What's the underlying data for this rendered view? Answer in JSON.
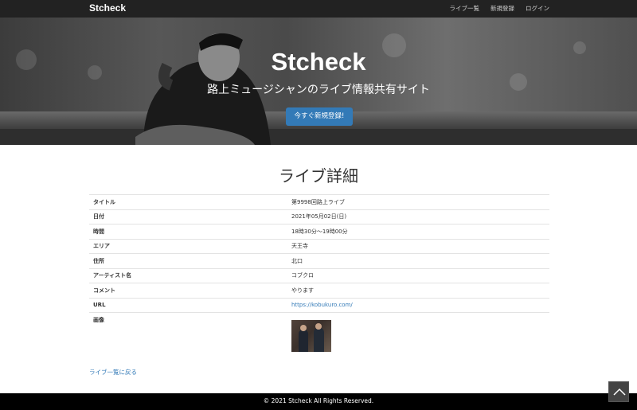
{
  "navbar": {
    "brand": "Stcheck",
    "links": [
      "ライブ一覧",
      "新規登録",
      "ログイン"
    ]
  },
  "hero": {
    "title": "Stcheck",
    "subtitle": "路上ミュージシャンのライブ情報共有サイト",
    "cta_label": "今すぐ新規登録!"
  },
  "page": {
    "title": "ライブ詳細"
  },
  "detail": {
    "rows": [
      {
        "label": "タイトル",
        "value": "第9998回路上ライブ"
      },
      {
        "label": "日付",
        "value": "2021年05月02日(日)"
      },
      {
        "label": "時間",
        "value": "18時30分〜19時00分"
      },
      {
        "label": "エリア",
        "value": "天王寺"
      },
      {
        "label": "住所",
        "value": "北口"
      },
      {
        "label": "アーティスト名",
        "value": "コブクロ"
      },
      {
        "label": "コメント",
        "value": "やります"
      }
    ],
    "url_label": "URL",
    "url_value": "https://kobukuro.com/",
    "image_label": "画像"
  },
  "back_link": "ライブ一覧に戻る",
  "footer": {
    "text": "© 2021 Stcheck All Rights Reserved."
  },
  "icons": {
    "scroll_top": "chevron-up-icon"
  },
  "colors": {
    "navbar_bg": "#222222",
    "primary": "#337ab7",
    "footer_bg": "#000000"
  }
}
